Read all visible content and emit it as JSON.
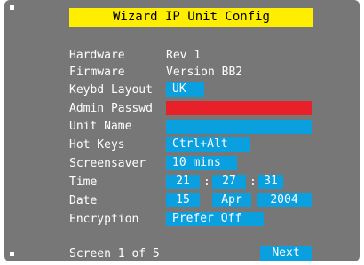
{
  "title": "Wizard IP Unit Config",
  "labels": {
    "hardware": "Hardware",
    "firmware": "Firmware",
    "keybd_layout": "Keybd Layout",
    "admin_passwd": "Admin Passwd",
    "unit_name": "Unit Name",
    "hot_keys": "Hot Keys",
    "screensaver": "Screensaver",
    "time": "Time",
    "date": "Date",
    "encryption": "Encryption"
  },
  "values": {
    "hardware": "Rev 1",
    "firmware": "Version BB2",
    "keybd_layout": "UK",
    "admin_passwd": "",
    "unit_name": "",
    "hot_keys": "Ctrl+Alt",
    "screensaver": "10 mins",
    "time_hh": "21",
    "time_mm": "27",
    "time_ss": "31",
    "time_sep": ":",
    "date_day": "15",
    "date_month": "Apr",
    "date_year": "2004",
    "encryption": "Prefer Off"
  },
  "footer": {
    "screen_text": "Screen 1 of 5",
    "next_label": "Next"
  },
  "colors": {
    "panel": "#777777",
    "field": "#0aa0e0",
    "title_bg": "#ffee00",
    "password_field": "#e8202a"
  }
}
